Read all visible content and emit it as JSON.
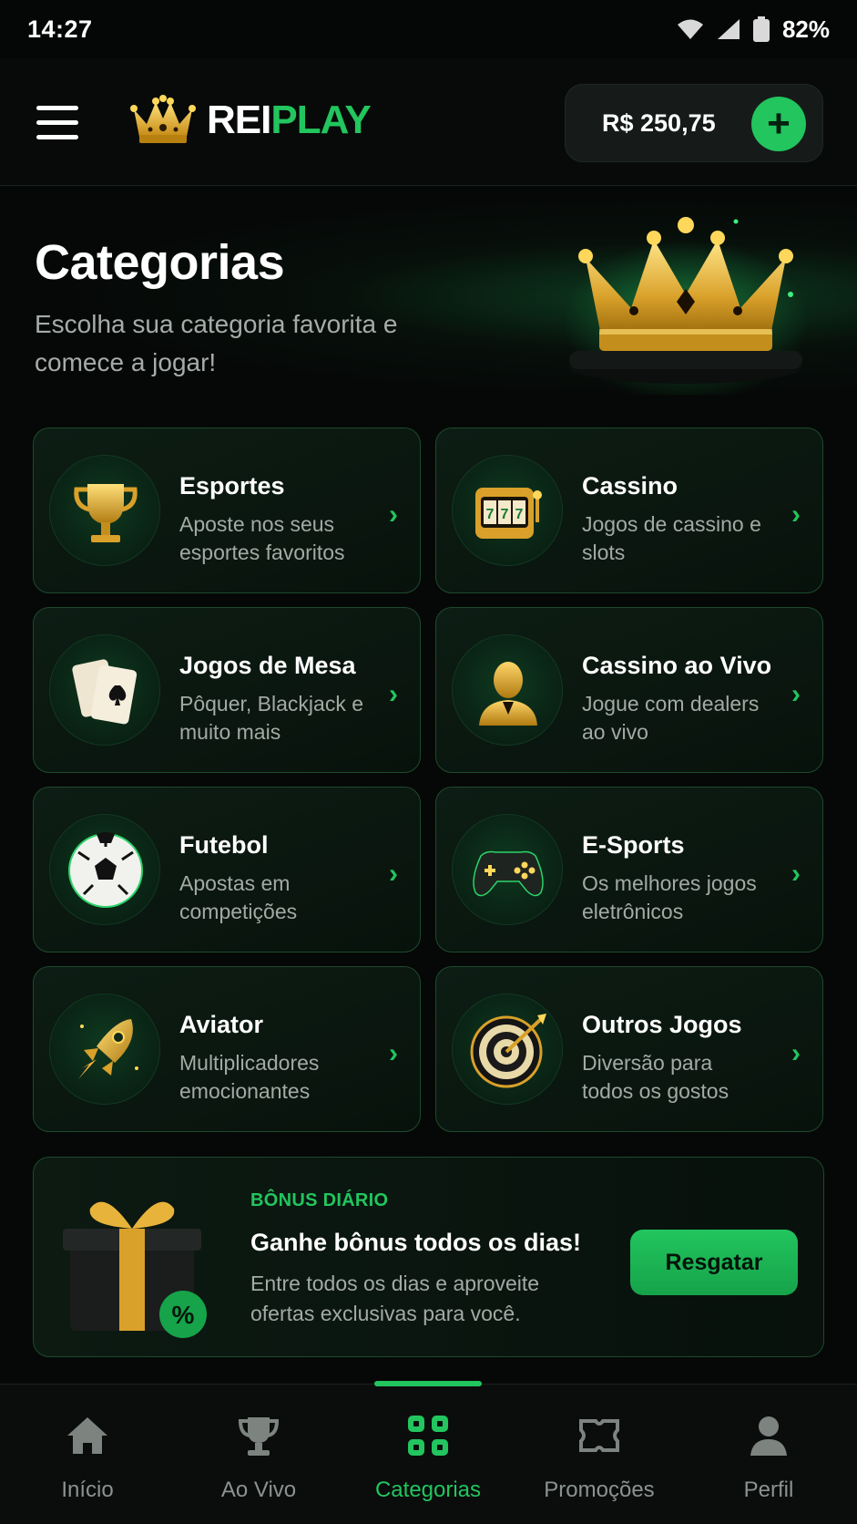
{
  "status_bar": {
    "time": "14:27",
    "battery": "82%"
  },
  "header": {
    "brand_part1": "REI",
    "brand_part2": "PLAY",
    "balance": "R$ 250,75",
    "add_label": "+"
  },
  "hero": {
    "title": "Categorias",
    "subtitle": "Escolha sua categoria favorita e comece a jogar!"
  },
  "categories": [
    {
      "title": "Esportes",
      "desc": "Aposte nos seus esportes favoritos",
      "icon": "trophy-icon"
    },
    {
      "title": "Cassino",
      "desc": "Jogos de cassino e slots",
      "icon": "slot-machine-icon"
    },
    {
      "title": "Jogos de Mesa",
      "desc": "Pôquer, Blackjack e muito mais",
      "icon": "playing-cards-icon"
    },
    {
      "title": "Cassino ao Vivo",
      "desc": "Jogue com dealers ao vivo",
      "icon": "dealer-icon"
    },
    {
      "title": "Futebol",
      "desc": "Apostas em competições",
      "icon": "soccer-ball-icon"
    },
    {
      "title": "E-Sports",
      "desc": "Os melhores jogos eletrônicos",
      "icon": "gamepad-icon"
    },
    {
      "title": "Aviator",
      "desc": "Multiplicadores emocionantes",
      "icon": "rocket-icon"
    },
    {
      "title": "Outros Jogos",
      "desc": "Diversão para todos os gostos",
      "icon": "dartboard-icon"
    }
  ],
  "bonus": {
    "tag": "BÔNUS DIÁRIO",
    "title": "Ganhe bônus todos os dias!",
    "desc": "Entre todos os dias e aproveite ofertas exclusivas para você.",
    "button": "Resgatar",
    "badge": "%"
  },
  "nav": [
    {
      "label": "Início",
      "icon": "home-icon"
    },
    {
      "label": "Ao Vivo",
      "icon": "trophy-icon"
    },
    {
      "label": "Categorias",
      "icon": "grid-icon",
      "active": true
    },
    {
      "label": "Promoções",
      "icon": "ticket-icon"
    },
    {
      "label": "Perfil",
      "icon": "user-icon"
    }
  ],
  "colors": {
    "accent": "#22c55e",
    "background": "#060807",
    "card_border": "#1d4a2d",
    "gold": "#e0b23a"
  }
}
